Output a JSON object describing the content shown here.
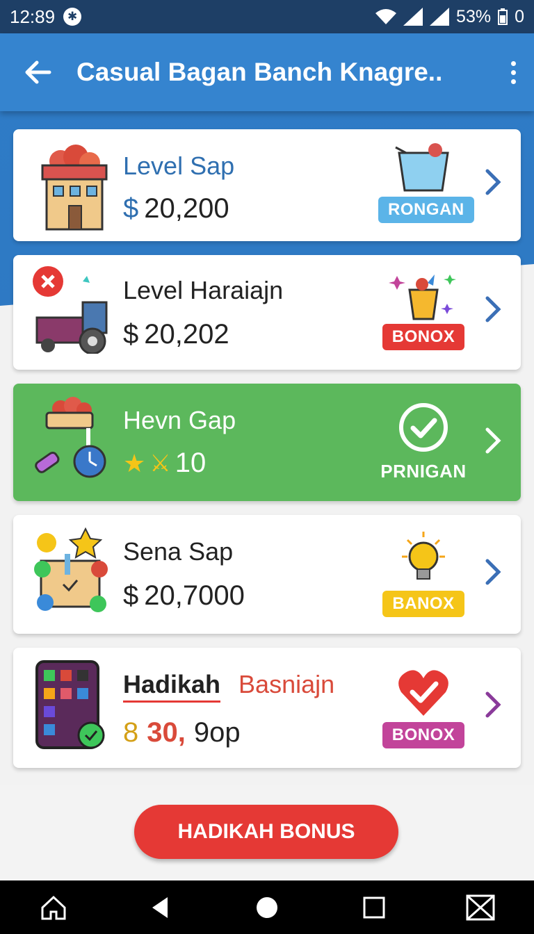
{
  "status_bar": {
    "time": "12:89",
    "battery": "53%",
    "extra": "0"
  },
  "app_bar": {
    "title": "Casual Bagan Banch Knagre.."
  },
  "cards": [
    {
      "title": "Level Sap",
      "currency": "$",
      "amount": "20,200",
      "badge": "RONGAN",
      "badge_color": "#5bb4e8"
    },
    {
      "title": "Level Haraiajn",
      "currency": "$",
      "amount": "20,202",
      "badge": "BONOX",
      "badge_color": "#e53935"
    },
    {
      "title": "Hevn Gap",
      "amount": "10",
      "badge": "PRNIGAN",
      "accent": "#5cb85c"
    },
    {
      "title": "Sena Sap",
      "currency": "$",
      "amount": "20,7000",
      "badge": "BANOX",
      "badge_color": "#f5c518"
    },
    {
      "title": "Hadikah",
      "subtitle": "Basniajn",
      "coin": "8",
      "amount_highlight": "30,",
      "amount_rest": "9op",
      "badge": "BONOX",
      "badge_color": "#c2449a"
    }
  ],
  "bonus_button": {
    "label": "HADIKAH BONUS"
  }
}
